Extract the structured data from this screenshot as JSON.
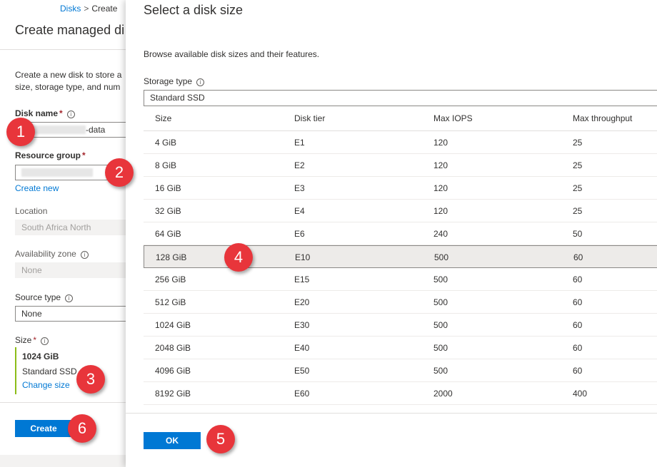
{
  "breadcrumb": {
    "parent": "Disks",
    "separator": ">",
    "current": "Create"
  },
  "blade": {
    "title": "Create managed di",
    "intro_line1": "Create a new disk to store a",
    "intro_line2": "size, storage type, and num",
    "disk_name": {
      "label": "Disk name",
      "required": "*",
      "value_suffix": "-data"
    },
    "resource_group": {
      "label": "Resource group",
      "required": "*",
      "create_new": "Create new"
    },
    "location": {
      "label": "Location",
      "value": "South Africa North"
    },
    "availability_zone": {
      "label": "Availability zone",
      "value": "None"
    },
    "source_type": {
      "label": "Source type",
      "value": "None"
    },
    "size": {
      "label": "Size",
      "required": "*",
      "value": "1024 GiB",
      "storage": "Standard SSD",
      "change": "Change size"
    },
    "create_label": "Create"
  },
  "dialog": {
    "title": "Select a disk size",
    "description": "Browse available disk sizes and their features.",
    "storage_type": {
      "label": "Storage type",
      "value": "Standard SSD"
    },
    "columns": [
      "Size",
      "Disk tier",
      "Max IOPS",
      "Max throughput"
    ],
    "rows": [
      [
        "4 GiB",
        "E1",
        "120",
        "25"
      ],
      [
        "8 GiB",
        "E2",
        "120",
        "25"
      ],
      [
        "16 GiB",
        "E3",
        "120",
        "25"
      ],
      [
        "32 GiB",
        "E4",
        "120",
        "25"
      ],
      [
        "64 GiB",
        "E6",
        "240",
        "50"
      ],
      [
        "128 GiB",
        "E10",
        "500",
        "60"
      ],
      [
        "256 GiB",
        "E15",
        "500",
        "60"
      ],
      [
        "512 GiB",
        "E20",
        "500",
        "60"
      ],
      [
        "1024 GiB",
        "E30",
        "500",
        "60"
      ],
      [
        "2048 GiB",
        "E40",
        "500",
        "60"
      ],
      [
        "4096 GiB",
        "E50",
        "500",
        "60"
      ],
      [
        "8192 GiB",
        "E60",
        "2000",
        "400"
      ]
    ],
    "selected_row": 5,
    "ok_label": "OK"
  },
  "icons": {
    "info": "info-icon"
  },
  "colors": {
    "accent": "#0078d4",
    "badge": "#e8353b",
    "required": "#a4262c",
    "size_bar": "#8cbd18"
  },
  "steps": [
    "1",
    "2",
    "3",
    "4",
    "5",
    "6"
  ]
}
